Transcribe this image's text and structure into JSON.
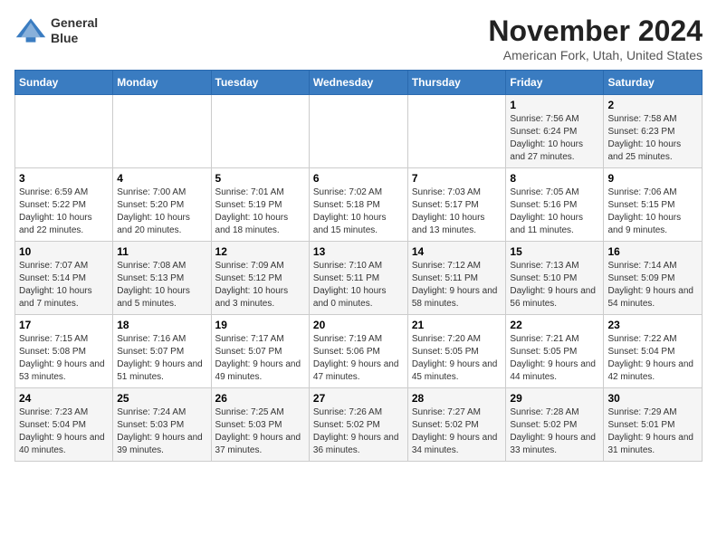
{
  "header": {
    "logo_line1": "General",
    "logo_line2": "Blue",
    "month": "November 2024",
    "location": "American Fork, Utah, United States"
  },
  "weekdays": [
    "Sunday",
    "Monday",
    "Tuesday",
    "Wednesday",
    "Thursday",
    "Friday",
    "Saturday"
  ],
  "weeks": [
    [
      {
        "day": "",
        "info": ""
      },
      {
        "day": "",
        "info": ""
      },
      {
        "day": "",
        "info": ""
      },
      {
        "day": "",
        "info": ""
      },
      {
        "day": "",
        "info": ""
      },
      {
        "day": "1",
        "info": "Sunrise: 7:56 AM\nSunset: 6:24 PM\nDaylight: 10 hours and 27 minutes."
      },
      {
        "day": "2",
        "info": "Sunrise: 7:58 AM\nSunset: 6:23 PM\nDaylight: 10 hours and 25 minutes."
      }
    ],
    [
      {
        "day": "3",
        "info": "Sunrise: 6:59 AM\nSunset: 5:22 PM\nDaylight: 10 hours and 22 minutes."
      },
      {
        "day": "4",
        "info": "Sunrise: 7:00 AM\nSunset: 5:20 PM\nDaylight: 10 hours and 20 minutes."
      },
      {
        "day": "5",
        "info": "Sunrise: 7:01 AM\nSunset: 5:19 PM\nDaylight: 10 hours and 18 minutes."
      },
      {
        "day": "6",
        "info": "Sunrise: 7:02 AM\nSunset: 5:18 PM\nDaylight: 10 hours and 15 minutes."
      },
      {
        "day": "7",
        "info": "Sunrise: 7:03 AM\nSunset: 5:17 PM\nDaylight: 10 hours and 13 minutes."
      },
      {
        "day": "8",
        "info": "Sunrise: 7:05 AM\nSunset: 5:16 PM\nDaylight: 10 hours and 11 minutes."
      },
      {
        "day": "9",
        "info": "Sunrise: 7:06 AM\nSunset: 5:15 PM\nDaylight: 10 hours and 9 minutes."
      }
    ],
    [
      {
        "day": "10",
        "info": "Sunrise: 7:07 AM\nSunset: 5:14 PM\nDaylight: 10 hours and 7 minutes."
      },
      {
        "day": "11",
        "info": "Sunrise: 7:08 AM\nSunset: 5:13 PM\nDaylight: 10 hours and 5 minutes."
      },
      {
        "day": "12",
        "info": "Sunrise: 7:09 AM\nSunset: 5:12 PM\nDaylight: 10 hours and 3 minutes."
      },
      {
        "day": "13",
        "info": "Sunrise: 7:10 AM\nSunset: 5:11 PM\nDaylight: 10 hours and 0 minutes."
      },
      {
        "day": "14",
        "info": "Sunrise: 7:12 AM\nSunset: 5:11 PM\nDaylight: 9 hours and 58 minutes."
      },
      {
        "day": "15",
        "info": "Sunrise: 7:13 AM\nSunset: 5:10 PM\nDaylight: 9 hours and 56 minutes."
      },
      {
        "day": "16",
        "info": "Sunrise: 7:14 AM\nSunset: 5:09 PM\nDaylight: 9 hours and 54 minutes."
      }
    ],
    [
      {
        "day": "17",
        "info": "Sunrise: 7:15 AM\nSunset: 5:08 PM\nDaylight: 9 hours and 53 minutes."
      },
      {
        "day": "18",
        "info": "Sunrise: 7:16 AM\nSunset: 5:07 PM\nDaylight: 9 hours and 51 minutes."
      },
      {
        "day": "19",
        "info": "Sunrise: 7:17 AM\nSunset: 5:07 PM\nDaylight: 9 hours and 49 minutes."
      },
      {
        "day": "20",
        "info": "Sunrise: 7:19 AM\nSunset: 5:06 PM\nDaylight: 9 hours and 47 minutes."
      },
      {
        "day": "21",
        "info": "Sunrise: 7:20 AM\nSunset: 5:05 PM\nDaylight: 9 hours and 45 minutes."
      },
      {
        "day": "22",
        "info": "Sunrise: 7:21 AM\nSunset: 5:05 PM\nDaylight: 9 hours and 44 minutes."
      },
      {
        "day": "23",
        "info": "Sunrise: 7:22 AM\nSunset: 5:04 PM\nDaylight: 9 hours and 42 minutes."
      }
    ],
    [
      {
        "day": "24",
        "info": "Sunrise: 7:23 AM\nSunset: 5:04 PM\nDaylight: 9 hours and 40 minutes."
      },
      {
        "day": "25",
        "info": "Sunrise: 7:24 AM\nSunset: 5:03 PM\nDaylight: 9 hours and 39 minutes."
      },
      {
        "day": "26",
        "info": "Sunrise: 7:25 AM\nSunset: 5:03 PM\nDaylight: 9 hours and 37 minutes."
      },
      {
        "day": "27",
        "info": "Sunrise: 7:26 AM\nSunset: 5:02 PM\nDaylight: 9 hours and 36 minutes."
      },
      {
        "day": "28",
        "info": "Sunrise: 7:27 AM\nSunset: 5:02 PM\nDaylight: 9 hours and 34 minutes."
      },
      {
        "day": "29",
        "info": "Sunrise: 7:28 AM\nSunset: 5:02 PM\nDaylight: 9 hours and 33 minutes."
      },
      {
        "day": "30",
        "info": "Sunrise: 7:29 AM\nSunset: 5:01 PM\nDaylight: 9 hours and 31 minutes."
      }
    ]
  ]
}
